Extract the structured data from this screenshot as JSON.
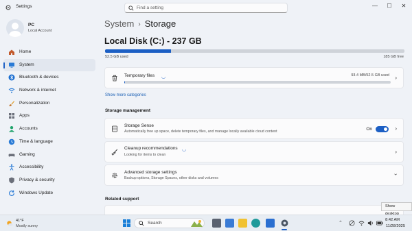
{
  "window": {
    "title": "Settings",
    "minimize": "—",
    "maximize": "☐",
    "close": "✕"
  },
  "search": {
    "placeholder": "Find a setting"
  },
  "profile": {
    "name": "PC",
    "account": "Local Account"
  },
  "nav": {
    "items": [
      {
        "label": "Home",
        "icon": "home-icon"
      },
      {
        "label": "System",
        "icon": "system-icon",
        "active": true
      },
      {
        "label": "Bluetooth & devices",
        "icon": "bluetooth-icon"
      },
      {
        "label": "Network & internet",
        "icon": "wifi-icon"
      },
      {
        "label": "Personalization",
        "icon": "brush-icon"
      },
      {
        "label": "Apps",
        "icon": "apps-icon"
      },
      {
        "label": "Accounts",
        "icon": "person-icon"
      },
      {
        "label": "Time & language",
        "icon": "globe-clock-icon"
      },
      {
        "label": "Gaming",
        "icon": "controller-icon"
      },
      {
        "label": "Accessibility",
        "icon": "accessibility-icon"
      },
      {
        "label": "Privacy & security",
        "icon": "shield-icon"
      },
      {
        "label": "Windows Update",
        "icon": "update-icon"
      }
    ]
  },
  "breadcrumb": {
    "parent": "System",
    "separator": "›",
    "current": "Storage"
  },
  "disk": {
    "title": "Local Disk (C:) - 237 GB",
    "used_label": "52.5 GB used",
    "free_label": "185 GB free",
    "used_fraction": 0.22
  },
  "temp_files": {
    "title": "Temporary files",
    "size_label": "93.4 MB/52.5 GB used",
    "used_fraction": 0.002
  },
  "show_more": "Show more categories",
  "storage_management": {
    "heading": "Storage management",
    "storage_sense": {
      "title": "Storage Sense",
      "desc": "Automatically free up space, delete temporary files, and manage locally available cloud content",
      "toggle_label": "On",
      "toggle_on": true
    },
    "cleanup": {
      "title": "Cleanup recommendations",
      "desc": "Looking for items to clean"
    },
    "advanced": {
      "title": "Advanced storage settings",
      "desc": "Backup options, Storage Spaces, other disks and volumes"
    }
  },
  "related": {
    "heading": "Related support"
  },
  "tooltip": "Show desktop",
  "taskbar": {
    "weather_temp": "41°F",
    "weather_cond": "Mostly sunny",
    "search_label": "Search",
    "time": "8:42 AM",
    "date": "11/28/2025",
    "accent": "#1c5fc4"
  }
}
